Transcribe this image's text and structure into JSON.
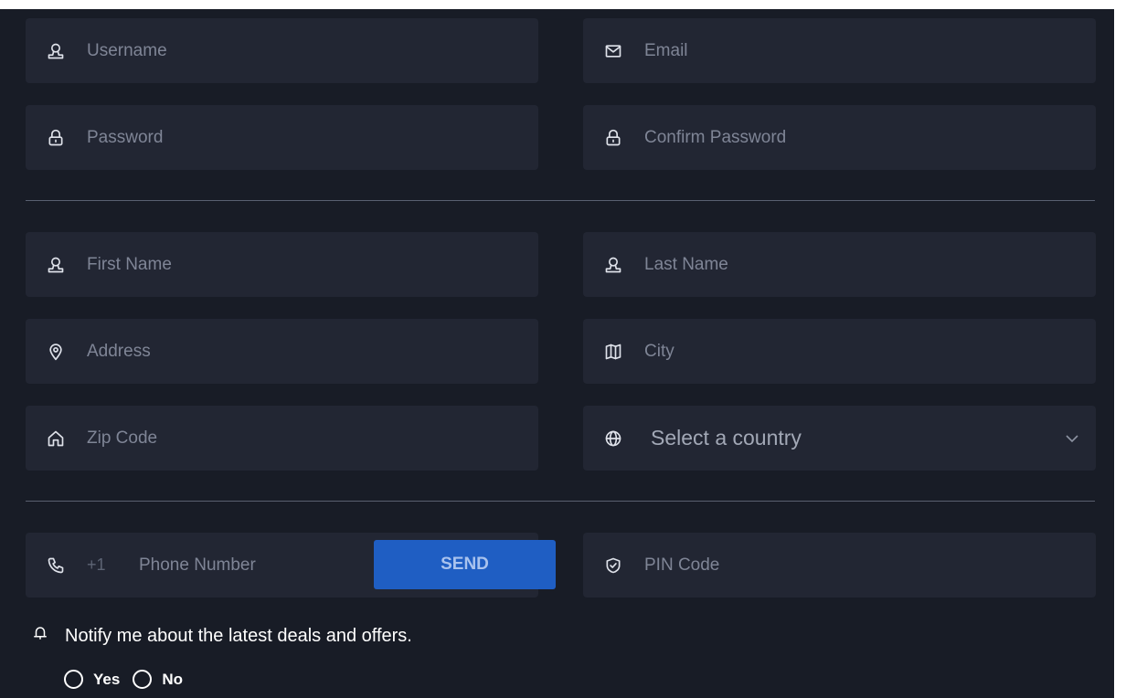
{
  "account": {
    "username": {
      "placeholder": "Username",
      "icon": "user-icon"
    },
    "email": {
      "placeholder": "Email",
      "icon": "mail-icon"
    },
    "password": {
      "placeholder": "Password",
      "icon": "lock-icon"
    },
    "confirm_password": {
      "placeholder": "Confirm Password",
      "icon": "lock-icon"
    }
  },
  "personal": {
    "first_name": {
      "placeholder": "First Name",
      "icon": "user-icon"
    },
    "last_name": {
      "placeholder": "Last Name",
      "icon": "user-icon"
    },
    "address": {
      "placeholder": "Address",
      "icon": "map-pin-icon"
    },
    "city": {
      "placeholder": "City",
      "icon": "map-icon"
    },
    "zip_code": {
      "placeholder": "Zip Code",
      "icon": "home-icon"
    },
    "country": {
      "selected": "Select a country",
      "icon": "globe-icon"
    }
  },
  "verification": {
    "phone_prefix": "+1",
    "phone": {
      "placeholder": "Phone Number",
      "icon": "phone-icon"
    },
    "send_label": "SEND",
    "pin": {
      "placeholder": "PIN Code",
      "icon": "shield-check-icon"
    }
  },
  "notifications": {
    "label": "Notify me about the latest deals and offers.",
    "options": [
      "Yes",
      "No"
    ]
  },
  "colors": {
    "panel_bg": "#181c26",
    "field_bg": "#222633",
    "accent": "#1f5ec3"
  }
}
